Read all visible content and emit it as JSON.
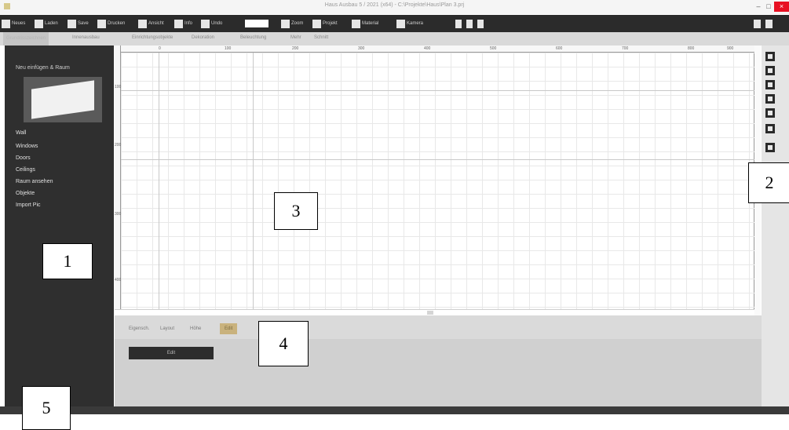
{
  "window": {
    "title": "Haus Ausbau 5 / 2021 (x64) - C:\\Projekte\\Haus\\Plan 3.prj",
    "minimize_label": "–",
    "maximize_label": "□",
    "close_label": "×"
  },
  "toolbar": {
    "items": [
      {
        "label": "Neues",
        "icon": "new-file-icon"
      },
      {
        "label": "Laden",
        "icon": "open-folder-icon"
      },
      {
        "label": "Save",
        "icon": "save-icon"
      },
      {
        "label": "Drucken",
        "icon": "print-icon"
      },
      {
        "label": "Ansicht",
        "icon": "view-icon"
      },
      {
        "label": "Info",
        "icon": "info-icon"
      },
      {
        "label": "Undo",
        "icon": "undo-icon"
      },
      {
        "label": "Zoom",
        "icon": "zoom-icon"
      },
      {
        "label": "Projekt",
        "icon": "project-icon"
      },
      {
        "label": "Material",
        "icon": "material-icon"
      },
      {
        "label": "Kamera",
        "icon": "camera-icon"
      }
    ]
  },
  "tabs": [
    {
      "label": "Grundrisszeichnen"
    },
    {
      "label": "Innenausbau"
    },
    {
      "label": "Einrichtungsobjekte"
    },
    {
      "label": "Dekoration"
    },
    {
      "label": "Beleuchtung"
    },
    {
      "label": "Mehr"
    },
    {
      "label": "Schnitt"
    }
  ],
  "sidebar": {
    "heading": "Neu einfügen & Raum",
    "items": [
      {
        "label": "Wall"
      },
      {
        "label": "Windows"
      },
      {
        "label": "Doors"
      },
      {
        "label": "Ceilings"
      },
      {
        "label": "Raum ansehen"
      },
      {
        "label": "Objekte"
      },
      {
        "label": "Import Pic"
      }
    ]
  },
  "ruler": {
    "top_ticks": [
      "0",
      "100",
      "200",
      "300",
      "400",
      "500",
      "600",
      "700",
      "800",
      "900"
    ],
    "left_ticks": [
      "100",
      "200",
      "300",
      "400",
      "500"
    ]
  },
  "right_tools": [
    {
      "icon": "select-icon"
    },
    {
      "icon": "wall-icon"
    },
    {
      "icon": "door-icon"
    },
    {
      "icon": "window-icon"
    },
    {
      "icon": "measure-icon"
    },
    {
      "icon": "line-icon"
    },
    {
      "icon": "pointer-icon"
    }
  ],
  "bottom_panel": {
    "tabs": [
      {
        "label": "Eigensch."
      },
      {
        "label": "Layout"
      },
      {
        "label": "Höhe"
      },
      {
        "label": "Edit"
      }
    ],
    "edit_button": "Edit"
  },
  "callouts": [
    "1",
    "2",
    "3",
    "4",
    "5"
  ]
}
